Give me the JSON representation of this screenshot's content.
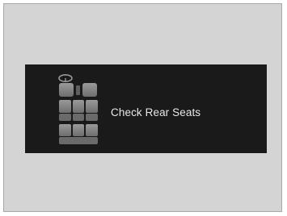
{
  "display": {
    "message": "Check Rear Seats",
    "icon": "rear-seat-reminder-icon",
    "background_color": "#1a1a1a",
    "text_color": "#e8e8e8",
    "seat_color": "#8a8a8a"
  }
}
